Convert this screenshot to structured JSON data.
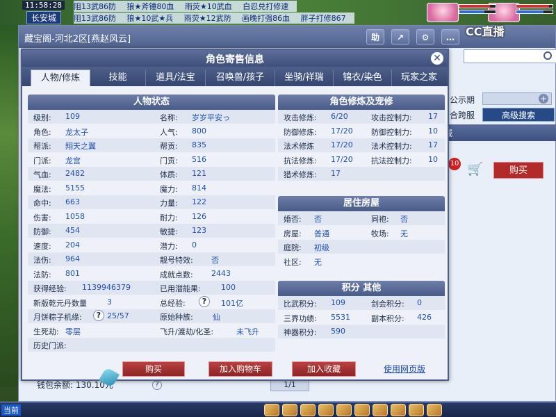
{
  "game": {
    "clock": "11:58:28",
    "city": "长安城",
    "ticker_rows": [
      [
        "阻13武86防",
        "狼★斧锤80血",
        "雨荧★10武血",
        "白忍兑打修速"
      ],
      [
        "阻13武86防",
        "狼★10武★兵",
        "雨荧★12武防",
        "画晚打强86血",
        "胖子打修867"
      ]
    ],
    "cc_logo": "CC直播",
    "current_label": "当前",
    "colors": {
      "hp_red": "#e02828",
      "mp_blue": "#2a6ae0"
    }
  },
  "bg_window": {
    "title": "藏宝阁-河北2区[燕赵风云]",
    "title_buttons": [
      {
        "name": "help-button",
        "label": "助"
      },
      {
        "name": "share-button",
        "label": "↗"
      },
      {
        "name": "settings-button",
        "label": "⚙"
      },
      {
        "name": "chat-button",
        "label": "…"
      }
    ],
    "side_labels": {
      "public_period": "公示期",
      "cross_server": "合跨服",
      "strip": "城"
    },
    "advanced_search": "高级搜索",
    "badge_count": "10",
    "buy": "购买",
    "wallet": "钱包余额: 130.10元",
    "page": "1/1"
  },
  "dialog": {
    "title": "角色寄售信息",
    "tabs": [
      "人物/修炼",
      "技能",
      "道具/法宝",
      "召唤兽/孩子",
      "坐骑/祥瑞",
      "锦衣/染色",
      "玩家之家"
    ],
    "char_status": {
      "header": "人物状态",
      "rows": [
        [
          [
            "级别:",
            "109"
          ],
          [
            "名称:",
            "岁岁平安っ"
          ]
        ],
        [
          [
            "角色:",
            "龙太子"
          ],
          [
            "人气:",
            "800"
          ]
        ],
        [
          [
            "帮派:",
            "翔天之翼"
          ],
          [
            "帮贡:",
            "835"
          ]
        ],
        [
          [
            "门派:",
            "龙宫"
          ],
          [
            "门贡:",
            "516"
          ]
        ],
        [
          [
            "气血:",
            "2482"
          ],
          [
            "体质:",
            "121"
          ]
        ],
        [
          [
            "魔法:",
            "5155"
          ],
          [
            "魔力:",
            "814"
          ]
        ],
        [
          [
            "命中:",
            "663"
          ],
          [
            "力量:",
            "122"
          ]
        ],
        [
          [
            "伤害:",
            "1058"
          ],
          [
            "耐力:",
            "126"
          ]
        ],
        [
          [
            "防御:",
            "454"
          ],
          [
            "敏捷:",
            "123"
          ]
        ],
        [
          [
            "速度:",
            "204"
          ],
          [
            "潜力:",
            "0"
          ]
        ],
        [
          [
            "法伤:",
            "964"
          ],
          [
            "靓号特效:",
            "否"
          ]
        ],
        [
          [
            "法防:",
            "801"
          ],
          [
            "成就点数:",
            "2443"
          ]
        ],
        [
          [
            "获得经验:",
            "1139946379"
          ],
          [
            "已用潜能果:",
            "100"
          ]
        ],
        [
          [
            "新版乾元丹数量",
            "3"
          ],
          [
            "总经验:",
            "101亿"
          ]
        ],
        [
          [
            "月饼粽子机缘:",
            "25/57"
          ],
          [
            "原始种族:",
            "仙"
          ]
        ],
        [
          [
            "生死劫:",
            "零层"
          ],
          [
            "飞升/渡劫/化圣:",
            "未飞升"
          ]
        ],
        [
          [
            "历史门派:",
            ""
          ],
          [
            "",
            ""
          ]
        ]
      ]
    },
    "cultivation": {
      "header": "角色修炼及宠修",
      "rows": [
        [
          [
            "攻击修炼:",
            "6/20"
          ],
          [
            "攻击控制力:",
            "17"
          ]
        ],
        [
          [
            "防御修炼:",
            "17/20"
          ],
          [
            "防御控制力:",
            "10"
          ]
        ],
        [
          [
            "法术修炼",
            "17/20"
          ],
          [
            "法术控制力:",
            "17"
          ]
        ],
        [
          [
            "抗法修炼:",
            "17/20"
          ],
          [
            "抗法控制力:",
            "10"
          ]
        ],
        [
          [
            "猎术修炼:",
            "17"
          ],
          [
            "",
            ""
          ]
        ]
      ]
    },
    "housing": {
      "header": "居住房屋",
      "rows": [
        [
          [
            "婚否:",
            "否"
          ],
          [
            "同袍:",
            "否"
          ]
        ],
        [
          [
            "房屋:",
            "普通"
          ],
          [
            "牧场:",
            "无"
          ]
        ],
        [
          [
            "庭院:",
            "初级"
          ],
          [
            "",
            ""
          ]
        ],
        [
          [
            "社区:",
            "无"
          ],
          [
            "",
            ""
          ]
        ]
      ]
    },
    "points": {
      "header": "积分 其他",
      "rows": [
        [
          [
            "比武积分:",
            "109"
          ],
          [
            "剑会积分:",
            "0"
          ]
        ],
        [
          [
            "三界功绩:",
            "5531"
          ],
          [
            "副本积分:",
            "426"
          ]
        ],
        [
          [
            "神器积分:",
            "590"
          ],
          [
            "",
            ""
          ]
        ]
      ]
    },
    "buttons": {
      "buy": "购买",
      "add_cart": "加入购物车",
      "add_fav": "加入收藏",
      "web": "使用网页版"
    },
    "qmark": "?"
  }
}
